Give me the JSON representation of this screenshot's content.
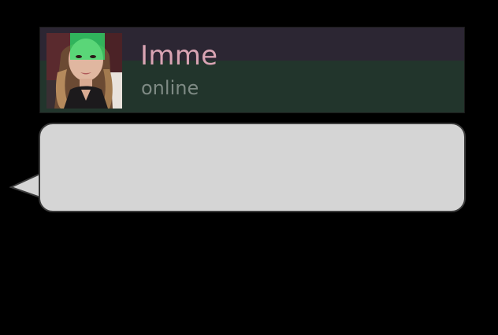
{
  "contact": {
    "name": "Imme",
    "status": "online",
    "avatar_icon": "profile-photo",
    "name_color": "#d9a3b3",
    "status_color": "#7e8a84"
  },
  "message": {
    "text": ""
  },
  "colors": {
    "background": "#000000",
    "bubble_fill": "#d5d5d5",
    "bubble_border": "#3c3c3c",
    "header_top": "#2c2633",
    "header_bottom": "#22352c"
  }
}
